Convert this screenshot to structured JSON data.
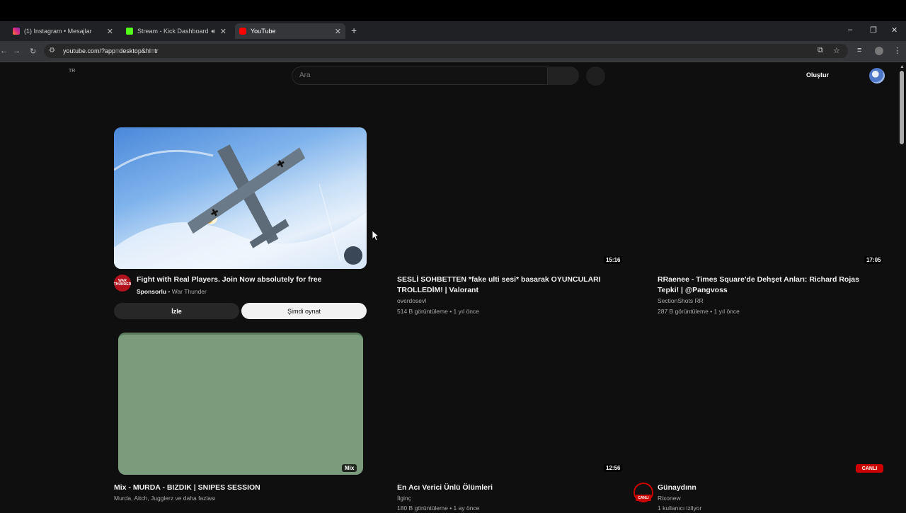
{
  "browser": {
    "tabs": [
      {
        "title": "(1) Instagram • Mesajlar",
        "close": "✕"
      },
      {
        "title": "Stream - Kick Dashboard",
        "close": "✕"
      },
      {
        "title": "YouTube",
        "close": "✕"
      }
    ],
    "new_tab": "+",
    "window_controls": {
      "minimize": "–",
      "restore": "❐",
      "close": "✕"
    },
    "nav": {
      "back": "←",
      "forward": "→",
      "reload": "↻"
    },
    "url": "youtube.com/?app=desktop&hl=tr",
    "right_icons": {
      "install": "⧉",
      "bookmark": "☆",
      "media": "≡",
      "menu": "⋮"
    }
  },
  "youtube": {
    "country_code": "TR",
    "search_placeholder": "Ara",
    "create_label": "Oluştur"
  },
  "ad": {
    "logo_text": "WAR THUNDER",
    "title": "Fight with Real Players. Join Now absolutely for free",
    "sponsored": "Sponsorlu",
    "separator": " • ",
    "advertiser": "War Thunder",
    "watch_button": "İzle",
    "play_button": "Şimdi oynat"
  },
  "videos": [
    {
      "title": "SESLİ SOHBETTEN *fake ulti sesi* basarak OYUNCULARI TROLLEDİM! | Valorant",
      "channel": "overdosevl",
      "stats": "514 B görüntüleme • 1 yıl önce",
      "duration": "15:16"
    },
    {
      "title": "RRaenee - Times Square'de Dehşet Anları: Richard Rojas Tepki! | @Pangvoss",
      "channel": "SectionShots RR",
      "stats": "287 B görüntüleme • 1 yıl önce",
      "duration": "17:05"
    },
    {
      "title": "Mix - MURDA - BIZDIK | SNIPES SESSION",
      "channel": "Murda, Aitch, Jugglerz ve daha fazlası",
      "badge": "Mix"
    },
    {
      "title": "En Acı Verici Ünlü Ölümleri",
      "channel": "İlginç",
      "stats": "180 B görüntüleme • 1 ay önce",
      "duration": "12:56"
    },
    {
      "title": "Günaydınn",
      "channel": "Rixonew",
      "stats": "1 kullanıcı izliyor",
      "badge": "CANLI",
      "avatar_tag": "CANLI"
    }
  ],
  "colors": {
    "background": "#0f0f0f",
    "live_red": "#cc0000",
    "mix_thumb": "#7b9b7d"
  }
}
